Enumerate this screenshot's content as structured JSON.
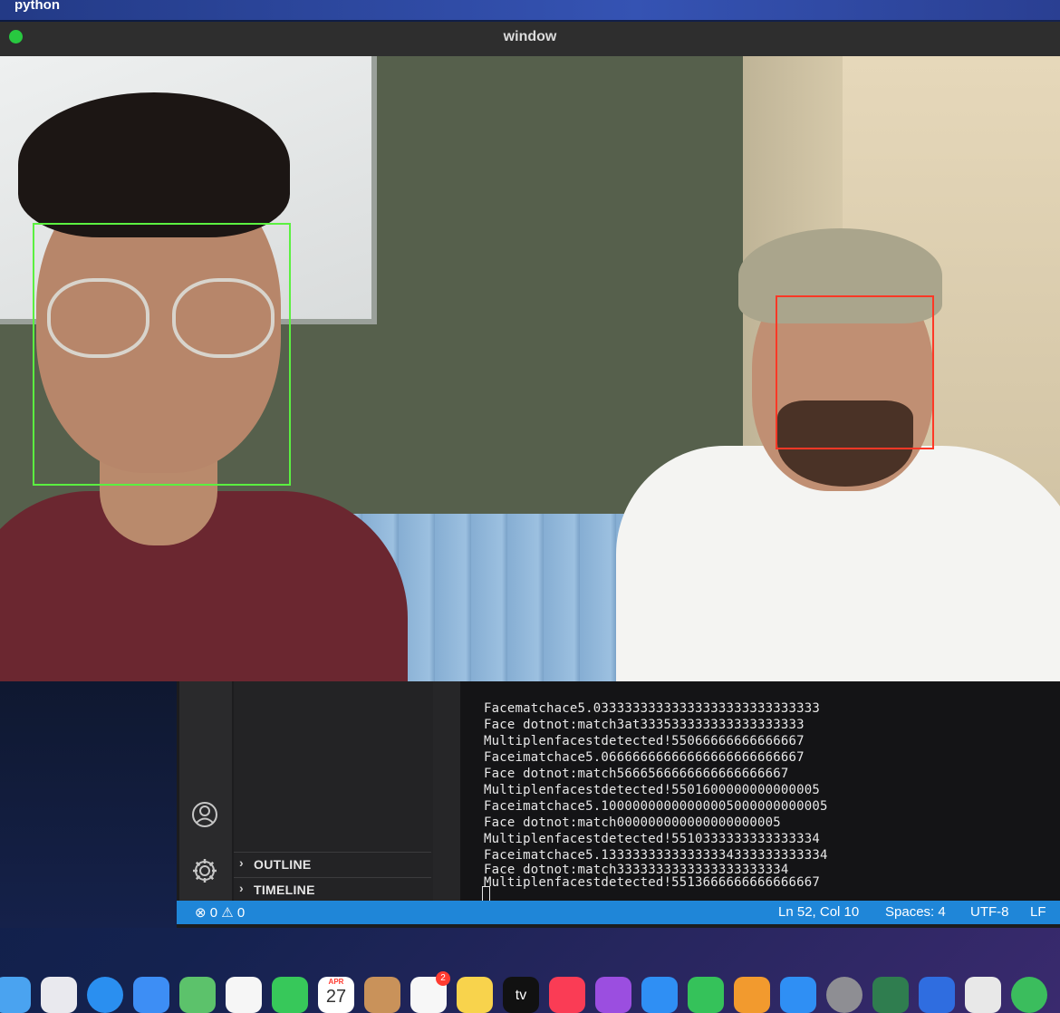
{
  "menubar": {
    "app_name": "python"
  },
  "camera_window": {
    "title": "window",
    "faces": [
      {
        "color": "#5bf040",
        "label": "green"
      },
      {
        "color": "#ff3826",
        "label": "red"
      }
    ]
  },
  "vscode": {
    "sidebar_sections": [
      {
        "label": "OUTLINE"
      },
      {
        "label": "TIMELINE"
      }
    ],
    "terminal_lines": [
      "Facematchace5.03333333333333333333333333333",
      "Face dotnot:match3at333533333333333333333",
      "Multiplenfacestdetected!55066666666666667",
      "Faceimatchace5.06666666666666666666666667",
      "Face dotnot:match5666566666666666666667",
      "Multiplenfacestdetected!5501600000000000005",
      "Faceimatchace5.10000000000000005000000000005",
      "Face dotnot:match000000000000000000005",
      "Multiplenfacestdetected!5510333333333333334",
      "Faceimatchace5.13333333333333334333333333334",
      "Face dotnot:match3333333333333333333334",
      "Multiplenfacestdetected!5513666666666666667"
    ],
    "statusbar": {
      "errors": "0",
      "warnings": "0",
      "position": "Ln 52, Col 10",
      "spaces": "Spaces: 4",
      "encoding": "UTF-8",
      "eol": "LF"
    }
  },
  "dock": {
    "calendar_month": "APR",
    "calendar_day": "27",
    "reminders_badge": "2",
    "tv_label": "tv",
    "apps": [
      {
        "name": "finder",
        "color": "#4aa3f0"
      },
      {
        "name": "launchpad",
        "color": "#e9e9ee"
      },
      {
        "name": "safari",
        "color": "#2a8ff0"
      },
      {
        "name": "mail",
        "color": "#3d8ef5"
      },
      {
        "name": "maps",
        "color": "#5cc26b"
      },
      {
        "name": "photos",
        "color": "#f6f6f6"
      },
      {
        "name": "facetime",
        "color": "#37c85a"
      },
      {
        "name": "calendar",
        "color": "#ffffff"
      },
      {
        "name": "contacts",
        "color": "#c9925a"
      },
      {
        "name": "reminders",
        "color": "#f7f7f7"
      },
      {
        "name": "notes",
        "color": "#f8d34c"
      },
      {
        "name": "tv",
        "color": "#111111"
      },
      {
        "name": "music",
        "color": "#fa3c55"
      },
      {
        "name": "podcasts",
        "color": "#9b4ee0"
      },
      {
        "name": "keynote",
        "color": "#2f8ff4"
      },
      {
        "name": "numbers",
        "color": "#35c25a"
      },
      {
        "name": "pages",
        "color": "#f29a2e"
      },
      {
        "name": "app-store",
        "color": "#2f8ff4"
      },
      {
        "name": "system-preferences",
        "color": "#8e8e93"
      },
      {
        "name": "unknown-1",
        "color": "#2f7d4f"
      },
      {
        "name": "unknown-2",
        "color": "#2f6de0"
      },
      {
        "name": "unknown-3",
        "color": "#e8e8e8"
      },
      {
        "name": "unknown-4",
        "color": "#3bbd5d"
      }
    ]
  }
}
